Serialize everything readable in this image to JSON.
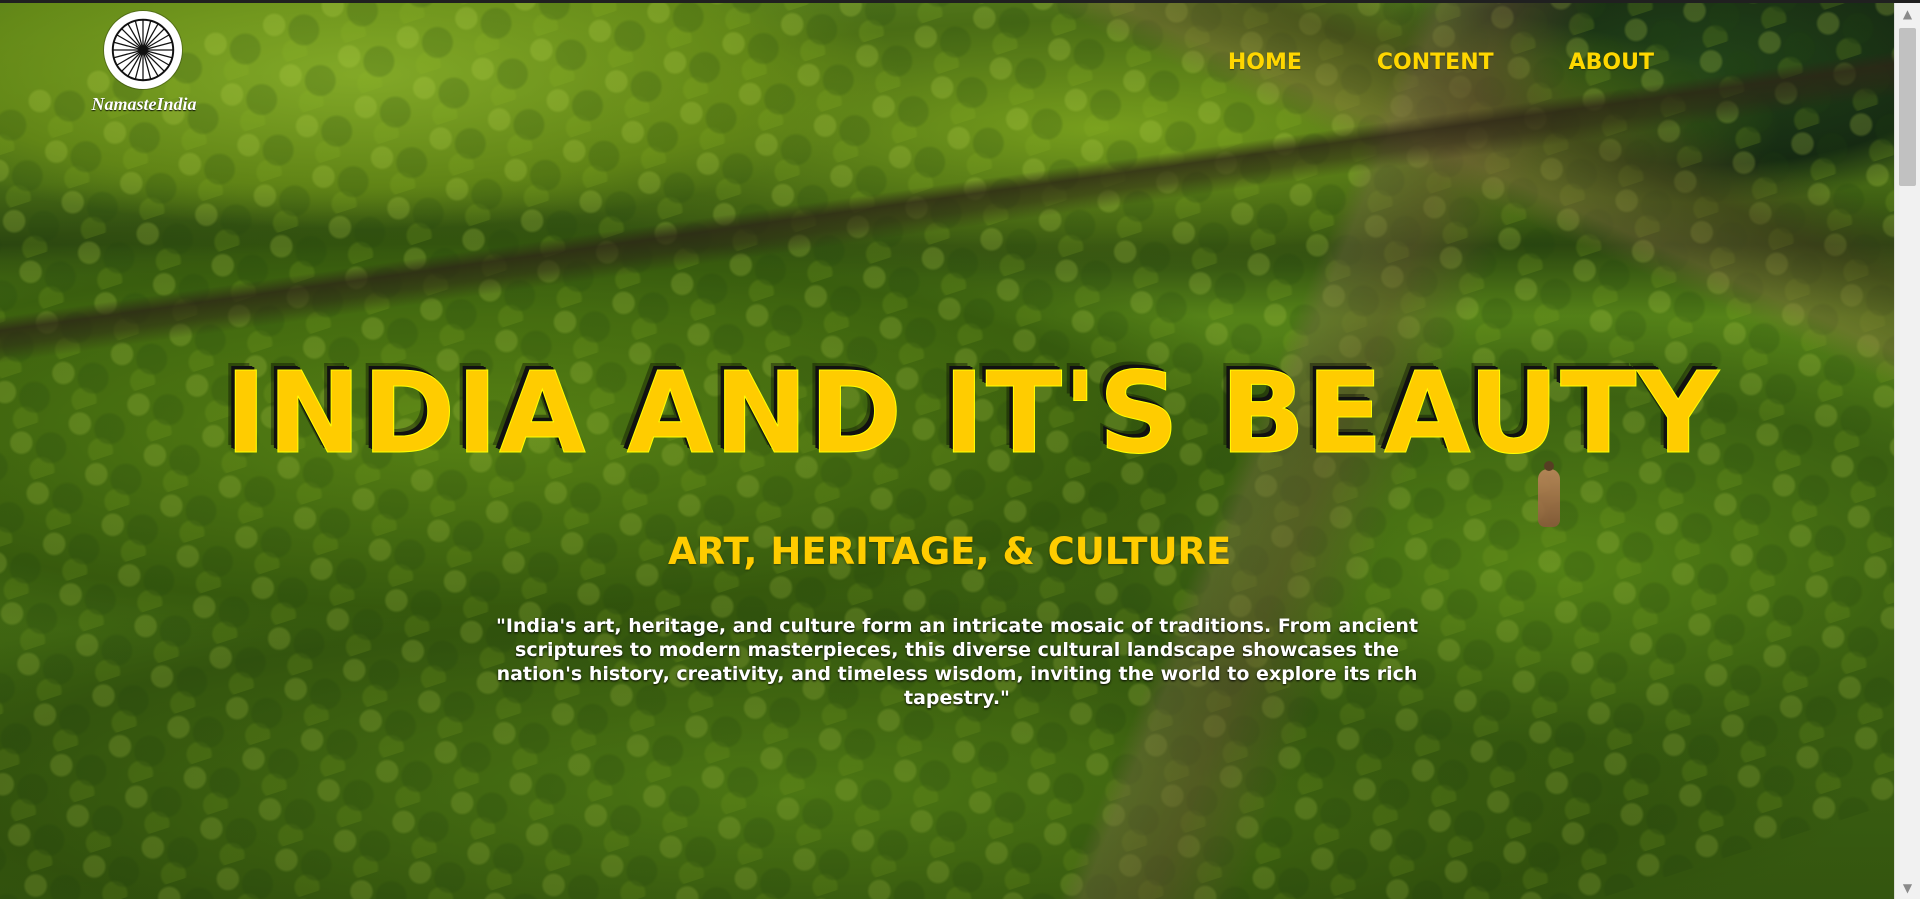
{
  "brand": {
    "name": "NamasteIndia",
    "logo_icon": "ashoka-chakra-icon"
  },
  "nav": {
    "items": [
      {
        "label": "HOME"
      },
      {
        "label": "CONTENT"
      },
      {
        "label": "ABOUT"
      }
    ],
    "color": "#ffd700"
  },
  "hero": {
    "title": "INDIA AND IT'S BEAUTY",
    "subtitle": "ART, HERITAGE, & CULTURE",
    "description": "\"India's art, heritage, and culture form an intricate mosaic of traditions. From ancient scriptures to modern masterpieces, this diverse cultural landscape showcases the nation's history, creativity, and timeless wisdom, inviting the world to explore its rich tapestry.\"",
    "title_color": "#ffcc00",
    "text_color": "#ffffff",
    "background": "tea-plantation-hills-image"
  },
  "scrollbar": {
    "up_icon": "scroll-up-arrow-icon",
    "down_icon": "scroll-down-arrow-icon"
  }
}
